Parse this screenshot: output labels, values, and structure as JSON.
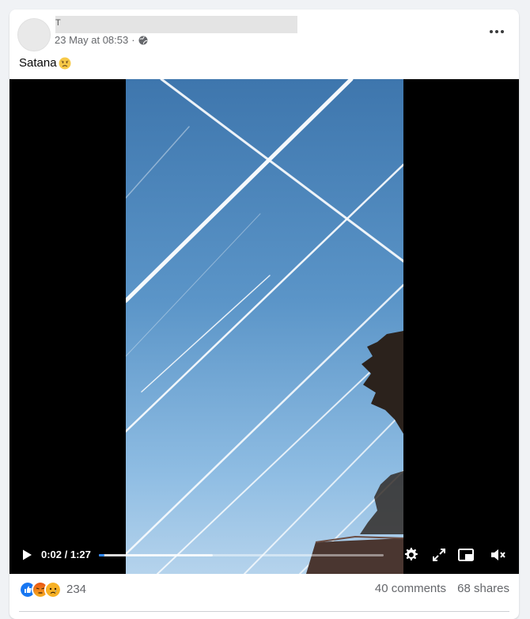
{
  "post": {
    "author_initial": "T",
    "timestamp": "23 May at 08:53",
    "separator": "·",
    "privacy_icon": "globe-icon",
    "text": "Satana",
    "emoji": "sad-face-emoji",
    "more_icon": "more-options-icon"
  },
  "video": {
    "current_time": "0:02",
    "time_separator": " / ",
    "duration": "1:27",
    "played_fraction": 0.02,
    "buffered_fraction": 0.4,
    "controls": [
      "play-icon",
      "settings-icon",
      "fullscreen-icon",
      "picture-in-picture-icon",
      "muted-speaker-icon"
    ]
  },
  "footer": {
    "reaction_icons": [
      "like-icon",
      "angry-icon",
      "sad-icon"
    ],
    "reaction_count": "234",
    "comments": "40 comments",
    "shares": "68 shares"
  },
  "colors": {
    "accent": "#2d88ff",
    "like": "#1877f2",
    "angry": "#e9710f",
    "sad": "#f7b125",
    "meta_text": "#65676b"
  }
}
